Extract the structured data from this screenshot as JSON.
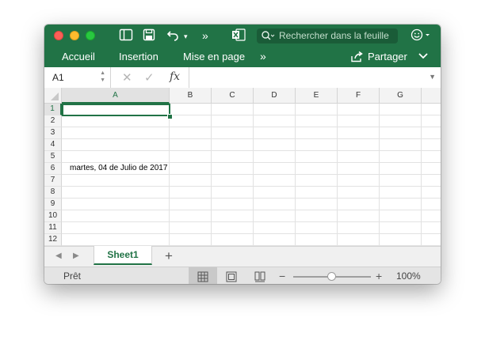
{
  "titlebar": {
    "search_placeholder": "Rechercher dans la feuille",
    "accent_color": "#217346"
  },
  "ribbon": {
    "tabs": [
      {
        "label": "Accueil"
      },
      {
        "label": "Insertion"
      },
      {
        "label": "Mise en page"
      }
    ],
    "more_label": "»",
    "share_label": "Partager"
  },
  "formula_bar": {
    "cell_ref": "A1",
    "fx_label": "fx",
    "formula": ""
  },
  "grid": {
    "columns": [
      "A",
      "B",
      "C",
      "D",
      "E",
      "F",
      "G"
    ],
    "rows": [
      "1",
      "2",
      "3",
      "4",
      "5",
      "6",
      "7",
      "8",
      "9",
      "10",
      "11",
      "12"
    ],
    "active_cell": "A1",
    "cells": {
      "A6": "martes, 04 de Julio de 2017"
    }
  },
  "sheets": {
    "tabs": [
      {
        "label": "Sheet1"
      }
    ],
    "add_label": "+"
  },
  "status": {
    "text": "Prêt",
    "zoom": "100%",
    "zoom_level": 1.0
  }
}
